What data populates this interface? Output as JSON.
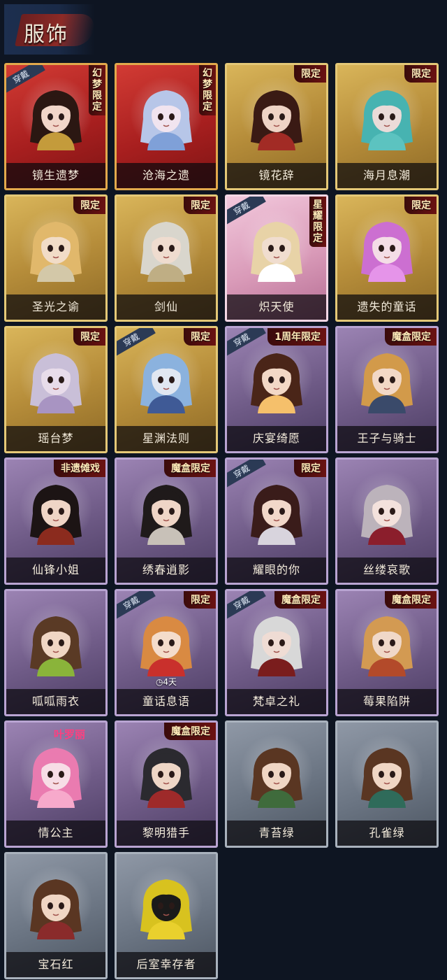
{
  "header": {
    "title": "服饰"
  },
  "cards": [
    {
      "name": "镜生遗梦",
      "tag": "幻梦限定",
      "tag_vertical": true,
      "worn": true,
      "theme": "red",
      "hair": "#2b1712",
      "skin": "#f2d6c9",
      "accent": "#c49b3b"
    },
    {
      "name": "沧海之遗",
      "tag": "幻梦限定",
      "tag_vertical": true,
      "worn": false,
      "theme": "red",
      "hair": "#b7c6e8",
      "skin": "#f1e4ef",
      "accent": "#7fa0d8"
    },
    {
      "name": "镜花辞",
      "tag": "限定",
      "tag_vertical": false,
      "worn": false,
      "theme": "gold",
      "hair": "#3a1a14",
      "skin": "#efd3c5",
      "accent": "#a22b25"
    },
    {
      "name": "海月息潮",
      "tag": "限定",
      "tag_vertical": false,
      "worn": false,
      "theme": "gold",
      "hair": "#47b3b1",
      "skin": "#eadbd8",
      "accent": "#5cc3c0"
    },
    {
      "name": "圣光之谕",
      "tag": "限定",
      "tag_vertical": false,
      "worn": false,
      "theme": "gold",
      "hair": "#e1b86b",
      "skin": "#f1dcc7",
      "accent": "#d3c8a8"
    },
    {
      "name": "剑仙",
      "tag": "限定",
      "tag_vertical": false,
      "worn": false,
      "theme": "gold",
      "hair": "#d9d6cd",
      "skin": "#efdccf",
      "accent": "#bfae84"
    },
    {
      "name": "炽天使",
      "tag": "星耀限定",
      "tag_vertical": true,
      "worn": true,
      "theme": "pink",
      "hair": "#e8d3a7",
      "skin": "#f0ddcf",
      "accent": "#ffffff"
    },
    {
      "name": "遗失的童话",
      "tag": "限定",
      "tag_vertical": false,
      "worn": false,
      "theme": "gold",
      "hair": "#cc6fd1",
      "skin": "#f4dde6",
      "accent": "#e594e9"
    },
    {
      "name": "瑶台梦",
      "tag": "限定",
      "tag_vertical": false,
      "worn": false,
      "theme": "gold",
      "hair": "#c9bfd8",
      "skin": "#e8dcea",
      "accent": "#a894c2"
    },
    {
      "name": "星渊法则",
      "tag": "限定",
      "tag_vertical": false,
      "worn": true,
      "theme": "gold",
      "hair": "#8bb2de",
      "skin": "#e1e7f1",
      "accent": "#3f5a96"
    },
    {
      "name": "庆宴绮愿",
      "tag": "1周年限定",
      "tag_vertical": false,
      "worn": true,
      "theme": "purple",
      "hair": "#4a2518",
      "skin": "#f2d8c6",
      "accent": "#f5c06b"
    },
    {
      "name": "王子与骑士",
      "tag": "魔盒限定",
      "tag_vertical": false,
      "worn": false,
      "theme": "purple",
      "hair": "#d29a4a",
      "skin": "#f2d8c6",
      "accent": "#3a4a6a"
    },
    {
      "name": "仙锋小姐",
      "tag": "非遗傩戏",
      "tag_vertical": false,
      "worn": false,
      "theme": "purple",
      "hair": "#1c1414",
      "skin": "#efd5c6",
      "accent": "#8b2b1e"
    },
    {
      "name": "绣春逍影",
      "tag": "魔盒限定",
      "tag_vertical": false,
      "worn": false,
      "theme": "purple",
      "hair": "#1f1a1a",
      "skin": "#efd5c6",
      "accent": "#c8c1b8"
    },
    {
      "name": "耀眼的你",
      "tag": "限定",
      "tag_vertical": false,
      "worn": true,
      "theme": "purple",
      "hair": "#3a1c1a",
      "skin": "#f1d7c9",
      "accent": "#d8d4dd"
    },
    {
      "name": "丝缕哀歌",
      "tag": "",
      "tag_vertical": false,
      "worn": false,
      "theme": "purple",
      "hair": "#bcb3bb",
      "skin": "#f3e1dc",
      "accent": "#8b1e2c"
    },
    {
      "name": "呱呱雨衣",
      "tag": "",
      "tag_vertical": false,
      "worn": false,
      "theme": "purple",
      "hair": "#5a3a25",
      "skin": "#f0d6c4",
      "accent": "#8ab43a"
    },
    {
      "name": "童话息语",
      "tag": "限定",
      "tag_vertical": false,
      "worn": true,
      "theme": "purple",
      "hair": "#d98a42",
      "skin": "#f4dccb",
      "accent": "#c9302c",
      "timer": "◷4天"
    },
    {
      "name": "梵卓之礼",
      "tag": "魔盒限定",
      "tag_vertical": false,
      "worn": true,
      "theme": "purple",
      "hair": "#d8d8d8",
      "skin": "#efdcd4",
      "accent": "#7a1d1d"
    },
    {
      "name": "莓果陷阱",
      "tag": "魔盒限定",
      "tag_vertical": false,
      "worn": false,
      "theme": "purple",
      "hair": "#d39a52",
      "skin": "#f0d8c8",
      "accent": "#b34a2a"
    },
    {
      "name": "情公主",
      "tag": "叶罗丽",
      "tag_vertical": false,
      "worn": false,
      "theme": "purple",
      "hair": "#ea7bb0",
      "skin": "#f7dde6",
      "accent": "#f7a9cb",
      "pink_label": true
    },
    {
      "name": "黎明猎手",
      "tag": "魔盒限定",
      "tag_vertical": false,
      "worn": false,
      "theme": "purple",
      "hair": "#2b2a2f",
      "skin": "#eed6c6",
      "accent": "#9e2a2a"
    },
    {
      "name": "青苔绿",
      "tag": "",
      "tag_vertical": false,
      "worn": false,
      "theme": "gray",
      "hair": "#5a3622",
      "skin": "#f0d6c4",
      "accent": "#3f6b3c"
    },
    {
      "name": "孔雀绿",
      "tag": "",
      "tag_vertical": false,
      "worn": false,
      "theme": "gray",
      "hair": "#5a3622",
      "skin": "#f0d6c4",
      "accent": "#2f6b5a"
    },
    {
      "name": "宝石红",
      "tag": "",
      "tag_vertical": false,
      "worn": false,
      "theme": "gray",
      "hair": "#5a3622",
      "skin": "#f0d6c4",
      "accent": "#8a2b2b"
    },
    {
      "name": "后室幸存者",
      "tag": "",
      "tag_vertical": false,
      "worn": false,
      "theme": "gray",
      "hair": "#d8c21f",
      "skin": "#1a1a1a",
      "accent": "#e9d02d"
    }
  ],
  "labels": {
    "worn": "穿戴"
  }
}
